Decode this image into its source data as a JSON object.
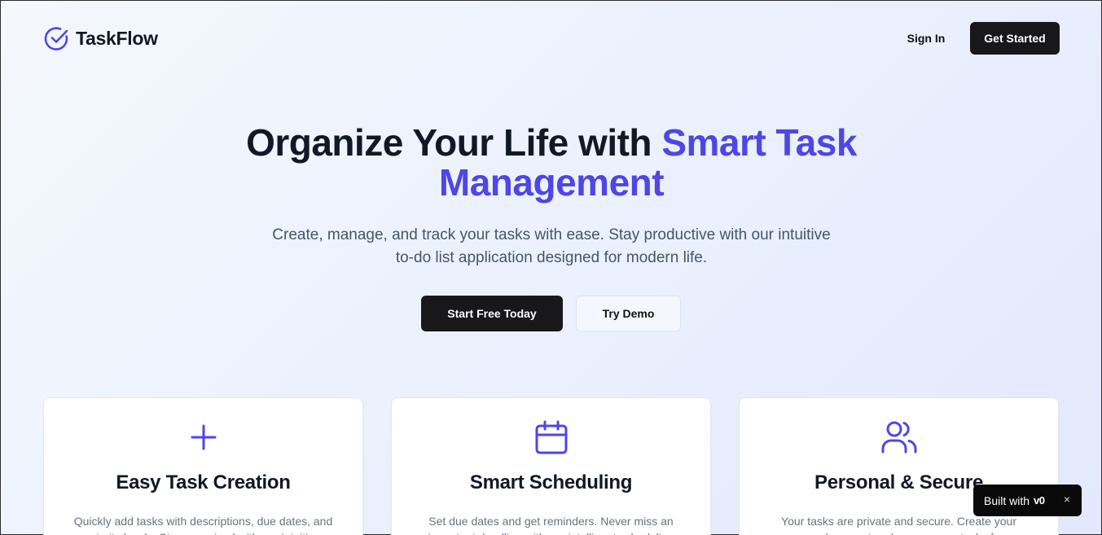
{
  "brand": {
    "name": "TaskFlow",
    "icon": "check-circle-icon",
    "accent_color": "#4f46e5"
  },
  "nav": {
    "sign_in": "Sign In",
    "get_started": "Get Started"
  },
  "hero": {
    "title_part1": "Organize Your Life with ",
    "title_accent": "Smart Task Management",
    "subtitle": "Create, manage, and track your tasks with ease. Stay productive with our intuitive to-do list application designed for modern life.",
    "primary_cta": "Start Free Today",
    "secondary_cta": "Try Demo"
  },
  "features": [
    {
      "icon": "plus-icon",
      "title": "Easy Task Creation",
      "description": "Quickly add tasks with descriptions, due dates, and priority levels. Stay organized with our intuitive"
    },
    {
      "icon": "calendar-icon",
      "title": "Smart Scheduling",
      "description": "Set due dates and get reminders. Never miss an important deadline with our intelligent scheduling"
    },
    {
      "icon": "users-icon",
      "title": "Personal & Secure",
      "description": "Your tasks are private and secure. Create your personal account and access your tasks from"
    }
  ],
  "badge": {
    "text": "Built with",
    "logo": "v0",
    "close": "×"
  }
}
